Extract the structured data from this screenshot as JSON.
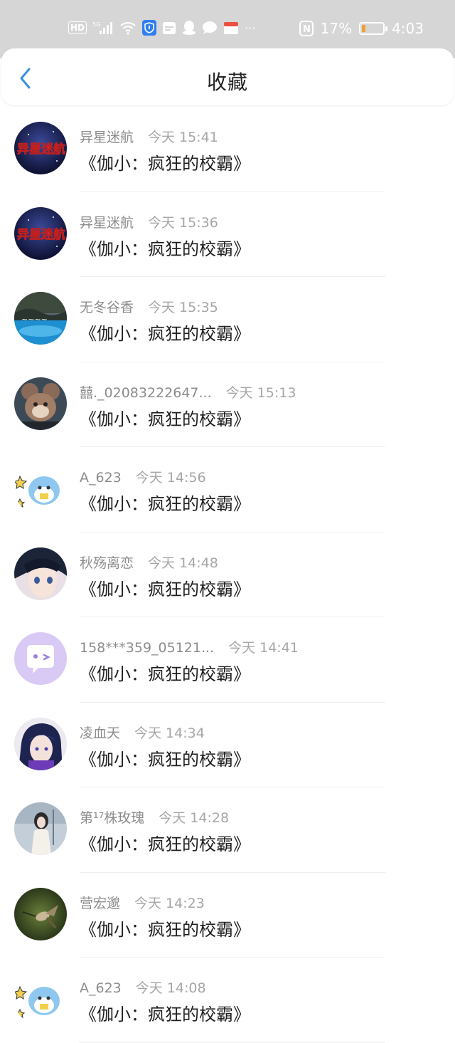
{
  "status_bar": {
    "left_icons": [
      "hd-icon",
      "signal-5g-icon",
      "wifi-icon",
      "shield-icon",
      "calendar-icon",
      "qq-icon",
      "chat-bubble-icon",
      "box-icon",
      "more-dots-icon"
    ],
    "hd": "HD",
    "signal": "5G",
    "more": "···",
    "nfc": "N",
    "battery": "17%",
    "battery_level": 0.17,
    "time": "4:03"
  },
  "header": {
    "title": "收藏",
    "back_icon": "chevron-left-icon",
    "accent": "#3a8ee6"
  },
  "items": [
    {
      "name": "异星迷航",
      "time": "今天 15:41",
      "content": "《伽小：疯狂的校霸》",
      "avatar": "galaxy"
    },
    {
      "name": "异星迷航",
      "time": "今天 15:36",
      "content": "《伽小：疯狂的校霸》",
      "avatar": "galaxy"
    },
    {
      "name": "无冬谷香",
      "time": "今天 15:35",
      "content": "《伽小：疯狂的校霸》",
      "avatar": "lake"
    },
    {
      "name": "囍._02083222647...",
      "time": "今天 15:13",
      "content": "《伽小：疯狂的校霸》",
      "avatar": "mouse"
    },
    {
      "name": "A_623",
      "time": "今天 14:56",
      "content": "《伽小：疯狂的校霸》",
      "avatar": "cartoon"
    },
    {
      "name": "秋殇离恋",
      "time": "今天 14:48",
      "content": "《伽小：疯狂的校霸》",
      "avatar": "anime"
    },
    {
      "name": "158***359_05121...",
      "time": "今天 14:41",
      "content": "《伽小：疯狂的校霸》",
      "avatar": "default"
    },
    {
      "name": "凌血天",
      "time": "今天 14:34",
      "content": "《伽小：疯狂的校霸》",
      "avatar": "anime2"
    },
    {
      "name": "第¹⁷株玫瑰",
      "time": "今天 14:28",
      "content": "《伽小：疯狂的校霸》",
      "avatar": "girl"
    },
    {
      "name": "营宏邈",
      "time": "今天 14:23",
      "content": "《伽小：疯狂的校霸》",
      "avatar": "bird"
    },
    {
      "name": "A_623",
      "time": "今天 14:08",
      "content": "《伽小：疯狂的校霸》",
      "avatar": "cartoon"
    }
  ]
}
